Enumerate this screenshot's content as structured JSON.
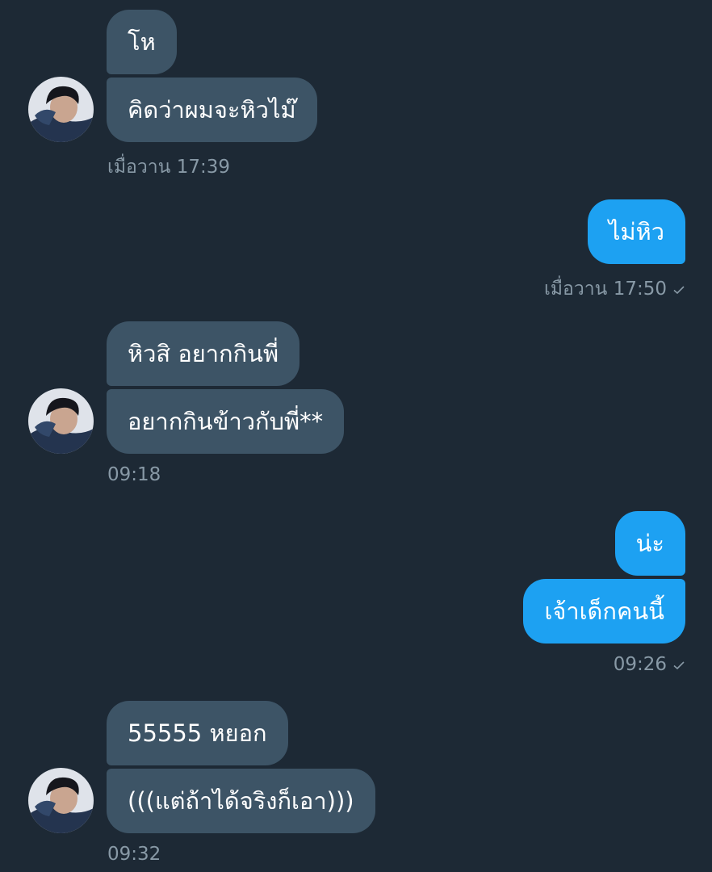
{
  "groups": [
    {
      "side": "in",
      "messages": [
        "โห",
        "คิดว่าผมจะหิวไม๊"
      ],
      "time": "เมื่อวาน 17:39",
      "read": false
    },
    {
      "side": "out",
      "messages": [
        "ไม่หิว"
      ],
      "time": "เมื่อวาน 17:50",
      "read": true
    },
    {
      "side": "in",
      "messages": [
        "หิวสิ อยากกินพี่",
        "อยากกินข้าวกับพี่**"
      ],
      "time": "09:18",
      "read": false
    },
    {
      "side": "out",
      "messages": [
        "น่ะ",
        "เจ้าเด็กคนนี้"
      ],
      "time": "09:26",
      "read": true
    },
    {
      "side": "in",
      "messages": [
        "55555 หยอก",
        "(((แต่ถ้าได้จริงก็เอา)))"
      ],
      "time": "09:32",
      "read": false
    }
  ],
  "icons": {
    "avatar": "user-avatar",
    "read_receipt": "check-icon"
  },
  "colors": {
    "background": "#1d2935",
    "incoming_bubble": "#3d5466",
    "outgoing_bubble": "#1da1f2",
    "timestamp": "#8899a6"
  }
}
